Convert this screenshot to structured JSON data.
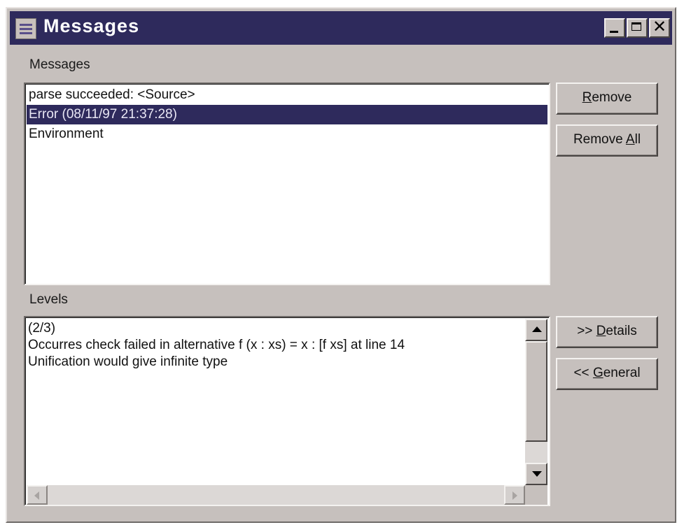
{
  "window": {
    "title": "Messages",
    "app_icon": "messages-app-icon",
    "controls": {
      "minimize": "minimize-icon",
      "maximize": "maximize-icon",
      "close": "close-icon",
      "close_glyph": "✕"
    }
  },
  "messages_group": {
    "label": "Messages",
    "items": [
      {
        "text": "parse succeeded: <Source>",
        "selected": false
      },
      {
        "text": "Error (08/11/97 21:37:28)",
        "selected": true
      },
      {
        "text": "Environment",
        "selected": false
      }
    ]
  },
  "buttons": {
    "remove": {
      "pre": "",
      "mnemonic": "R",
      "post": "emove"
    },
    "remove_all": {
      "pre": "Remove ",
      "mnemonic": "A",
      "post": "ll"
    },
    "details": {
      "pre": ">> ",
      "mnemonic": "D",
      "post": "etails"
    },
    "general": {
      "pre": "<< ",
      "mnemonic": "G",
      "post": "eneral"
    }
  },
  "levels_group": {
    "label": "Levels",
    "lines": [
      "(2/3)",
      "Occurres check failed in alternative f (x : xs)  = x : [f xs] at line 14",
      "Unification would give infinite type"
    ]
  },
  "colors": {
    "titlebar": "#2e2a5c",
    "window_face": "#c6c0bd",
    "selection": "#2e2a5c"
  }
}
